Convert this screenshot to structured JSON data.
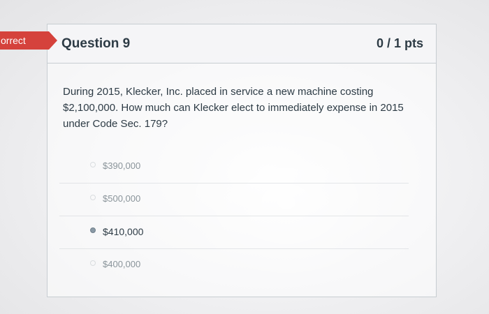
{
  "status_banner": {
    "label": "Incorrect",
    "visible_label": "orrect",
    "color": "#d5423c"
  },
  "question": {
    "title": "Question 9",
    "points": "0 / 1 pts",
    "text": "During 2015, Klecker, Inc. placed in service a new machine costing $2,100,000. How much can Klecker elect to immediately expense in 2015 under Code Sec. 179?"
  },
  "answers": [
    {
      "label": "$390,000",
      "selected": false
    },
    {
      "label": "$500,000",
      "selected": false
    },
    {
      "label": "$410,000",
      "selected": true
    },
    {
      "label": "$400,000",
      "selected": false
    }
  ],
  "colors": {
    "text": "#2d3b45",
    "border": "#c7cdd1",
    "header_bg": "#f5f5f7"
  }
}
